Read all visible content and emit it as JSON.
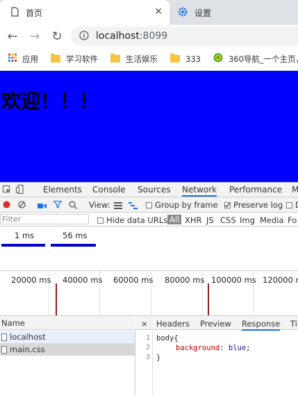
{
  "browser": {
    "tabs": [
      {
        "title": "首页",
        "icon": "page-icon",
        "active": true
      },
      {
        "title": "设置",
        "icon": "gear-icon",
        "active": false
      }
    ],
    "url_host": "localhost",
    "url_port": ":8099",
    "bookmarks": [
      {
        "label": "应用",
        "icon": "apps-grid-icon"
      },
      {
        "label": "学习软件",
        "icon": "folder-icon"
      },
      {
        "label": "生活娱乐",
        "icon": "folder-icon"
      },
      {
        "label": "333",
        "icon": "folder-icon"
      },
      {
        "label": "360导航_一个主页，",
        "icon": "360-logo-icon"
      }
    ]
  },
  "page": {
    "heading": "欢迎！！！",
    "background": "#0000ff"
  },
  "devtools": {
    "tabs": [
      "Elements",
      "Console",
      "Sources",
      "Network",
      "Performance",
      "M"
    ],
    "active_tab": "Network",
    "toolbar": {
      "view_label": "View:",
      "group_by_frame": "Group by frame",
      "group_by_frame_checked": false,
      "preserve_log": "Preserve log",
      "preserve_log_checked": true,
      "disable_cache_partial": "D"
    },
    "filter": {
      "placeholder": "Filter",
      "hide_data_urls": "Hide data URLs",
      "types": [
        "All",
        "XHR",
        "JS",
        "CSS",
        "Img",
        "Media",
        "Fo"
      ]
    },
    "overview": {
      "labels": [
        "1 ms",
        "56 ms"
      ]
    },
    "timeline": {
      "ticks": [
        "20000 ms",
        "40000 ms",
        "60000 ms",
        "80000 ms",
        "100000 ms",
        "120000 ms"
      ]
    },
    "request_list": {
      "header": "Name",
      "rows": [
        "localhost",
        "main.css"
      ]
    },
    "detail": {
      "close": "×",
      "tabs": [
        "Headers",
        "Preview",
        "Response",
        "Ti"
      ],
      "active_tab": "Response",
      "line_numbers": [
        "1",
        "2",
        "3"
      ],
      "code_line1": "body{",
      "code_prop": "background",
      "code_colon": ": ",
      "code_value": "blue",
      "code_semicolon": ";",
      "code_line3": "}"
    }
  }
}
